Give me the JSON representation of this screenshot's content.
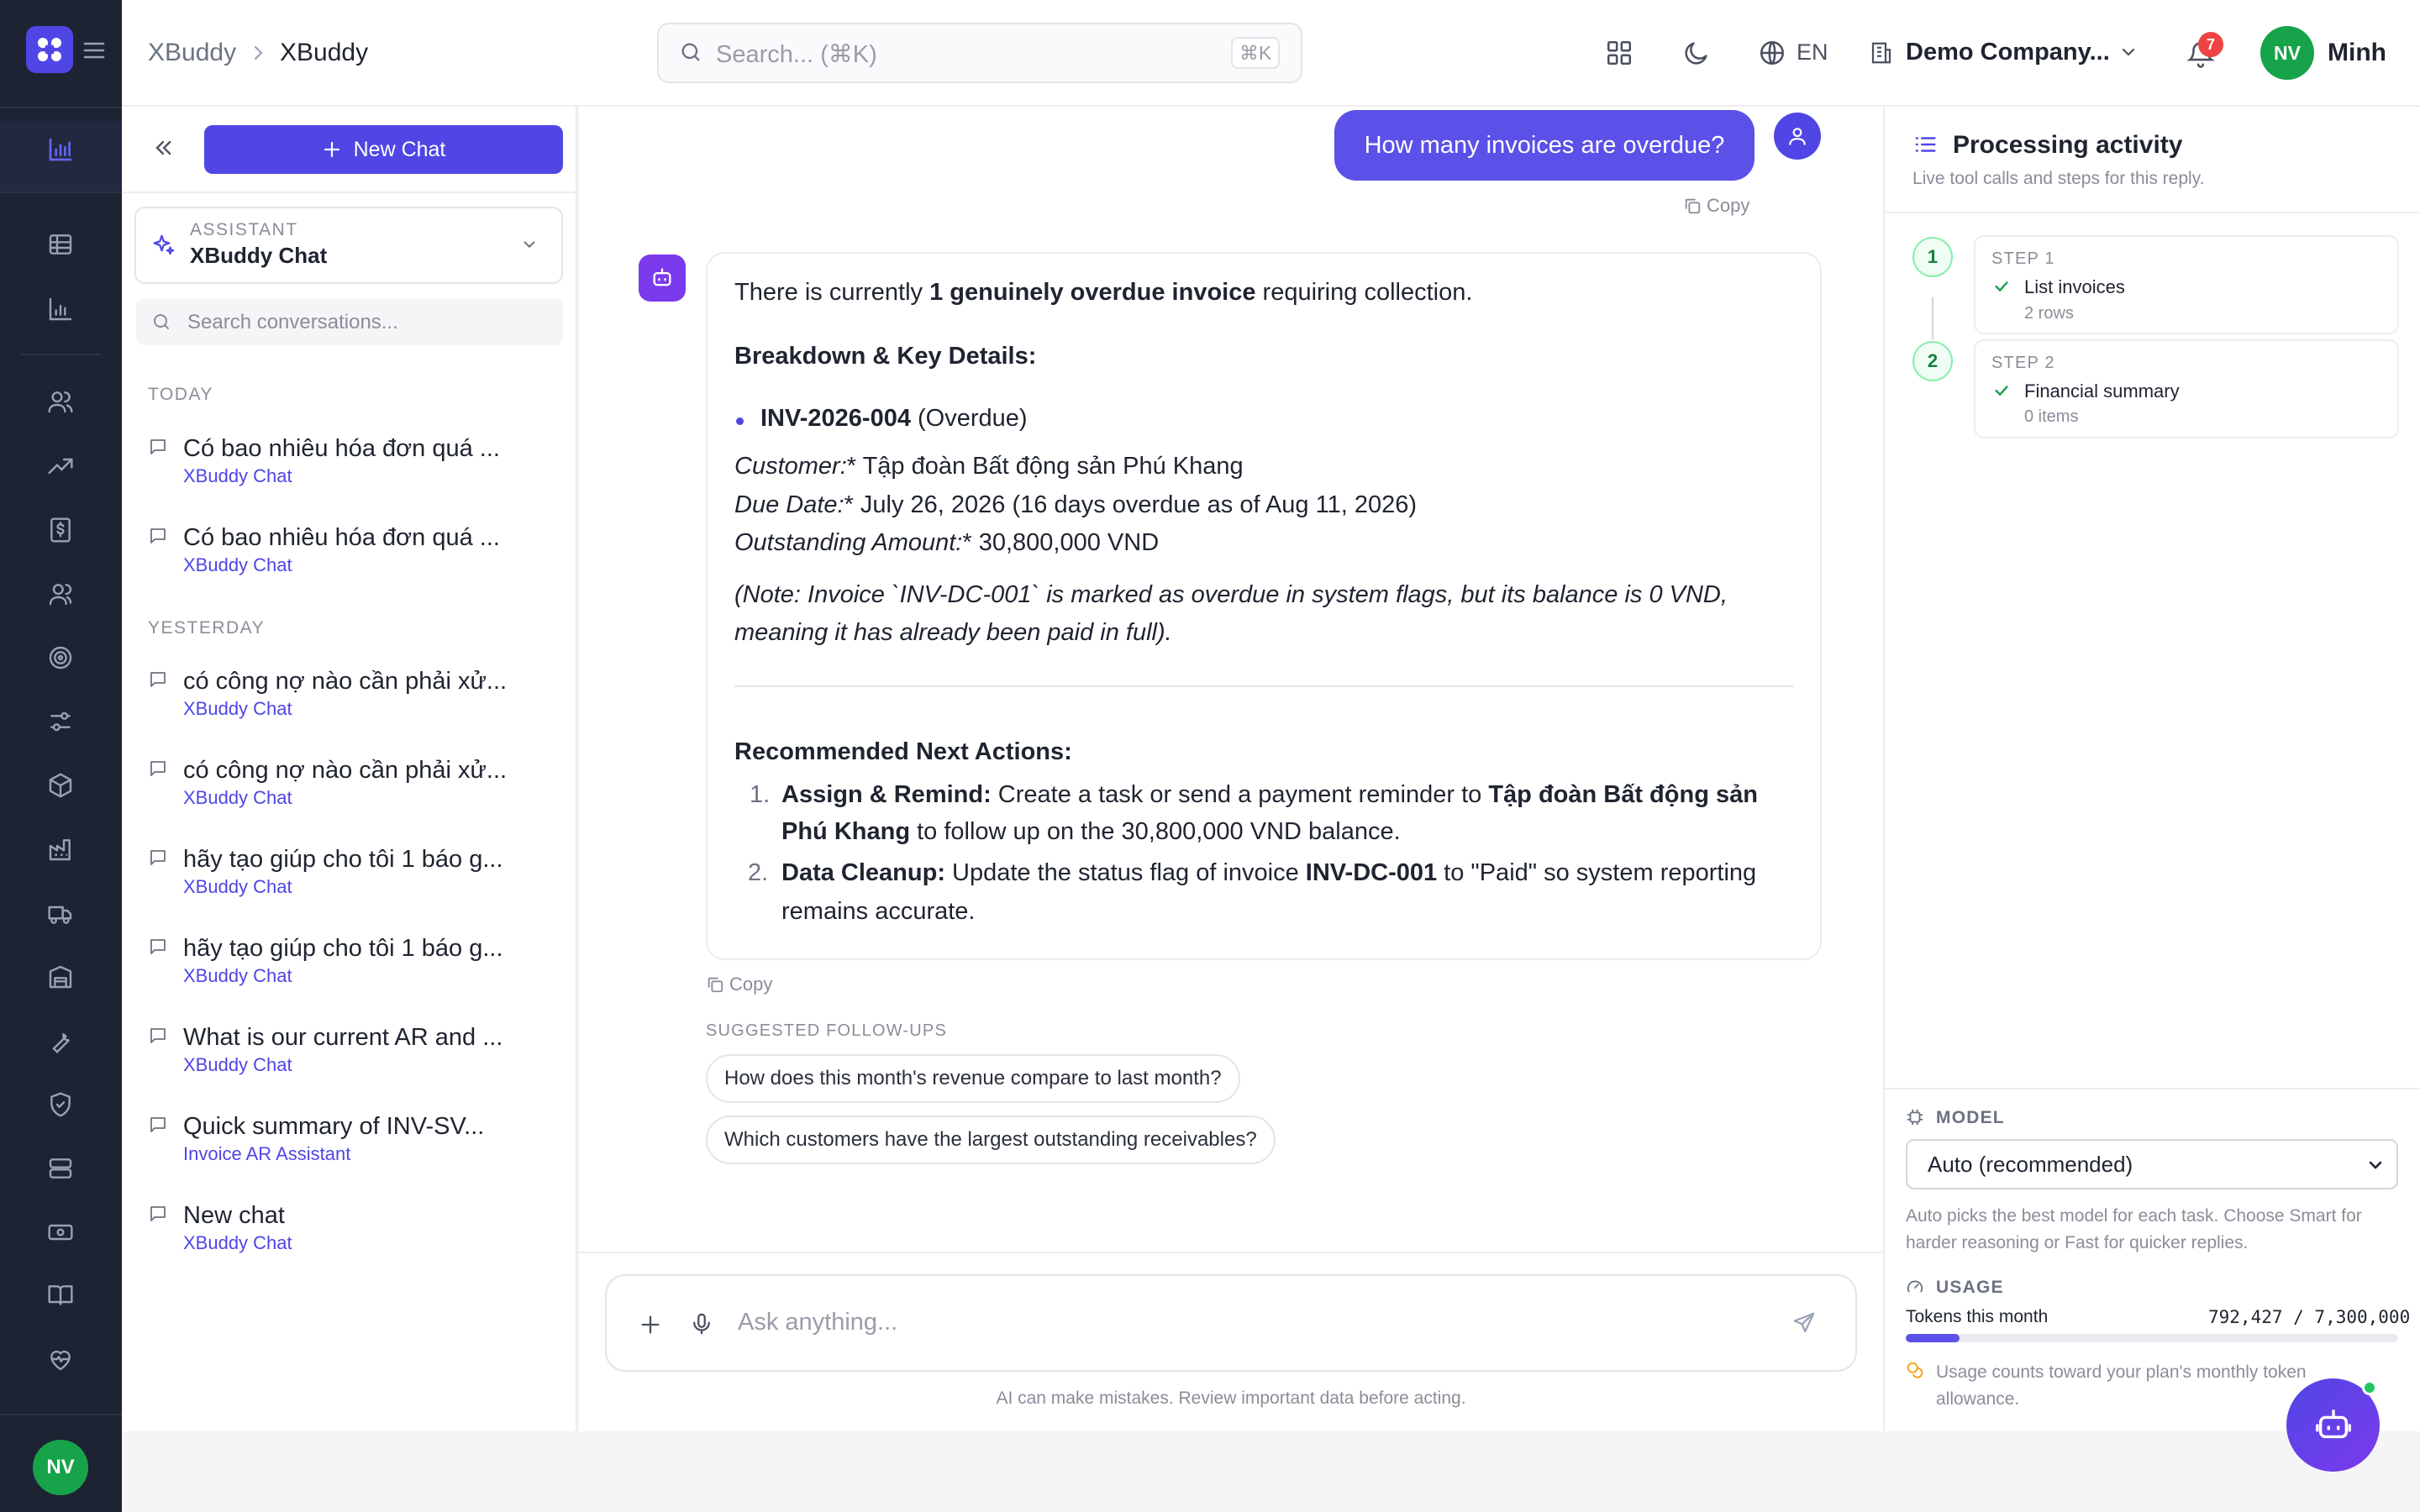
{
  "breadcrumb": {
    "parent": "XBuddy",
    "current": "XBuddy"
  },
  "search": {
    "placeholder": "Search... (⌘K)",
    "shortcut": "⌘K"
  },
  "header": {
    "language": "EN",
    "company": "Demo Company...",
    "notifications": "7",
    "user_initials": "NV",
    "user_name": "Minh"
  },
  "rail": {
    "avatar": "NV"
  },
  "sidebar": {
    "new_chat": "New Chat",
    "assistant_caption": "ASSISTANT",
    "assistant_name": "XBuddy Chat",
    "search_placeholder": "Search conversations...",
    "groups": [
      {
        "label": "TODAY",
        "items": [
          {
            "title": "Có bao nhiêu hóa đơn quá ...",
            "sub": "XBuddy Chat"
          },
          {
            "title": "Có bao nhiêu hóa đơn quá ...",
            "sub": "XBuddy Chat"
          }
        ]
      },
      {
        "label": "YESTERDAY",
        "items": [
          {
            "title": "có công nợ nào cần phải xử...",
            "sub": "XBuddy Chat"
          },
          {
            "title": "có công nợ nào cần phải xử...",
            "sub": "XBuddy Chat"
          },
          {
            "title": "hãy tạo giúp cho tôi 1 báo g...",
            "sub": "XBuddy Chat"
          },
          {
            "title": "hãy tạo giúp cho tôi 1 báo g...",
            "sub": "XBuddy Chat"
          },
          {
            "title": "What is our current AR and ...",
            "sub": "XBuddy Chat"
          },
          {
            "title": "Quick summary of INV-SV...",
            "sub": "Invoice AR Assistant"
          },
          {
            "title": "New chat",
            "sub": "XBuddy Chat"
          }
        ]
      }
    ]
  },
  "chat": {
    "user_message": "How many invoices are overdue?",
    "copy_label": "Copy",
    "reply": {
      "intro_pre": "There is currently ",
      "intro_bold": "1 genuinely overdue invoice",
      "intro_post": " requiring collection.",
      "breakdown_heading": "Breakdown & Key Details:",
      "invoice_id": "INV-2026-004",
      "invoice_status": " (Overdue)",
      "customer_label": "Customer:",
      "customer_value": "* Tập đoàn Bất động sản Phú Khang",
      "due_label": "Due Date:",
      "due_value": "* July 26, 2026 (16 days overdue as of Aug 11, 2026)",
      "amount_label": "Outstanding Amount:",
      "amount_value": "* 30,800,000 VND",
      "note_line1": "(Note: Invoice `INV-DC-001` is marked as overdue in system flags, but its balance is 0 VND,",
      "note_line2": "meaning it has already been paid in full).",
      "actions_heading": "Recommended Next Actions:",
      "action1_num": "1.",
      "action1_bold": "Assign & Remind:",
      "action1_text": " Create a task or send a payment reminder to ",
      "action1_bold2": "Tập đoàn Bất động sản",
      "action1_line2_bold": "Phú Khang",
      "action1_line2_text": " to follow up on the 30,800,000 VND balance.",
      "action2_num": "2.",
      "action2_bold": "Data Cleanup:",
      "action2_text": " Update the status flag of invoice ",
      "action2_bold2": "INV-DC-001",
      "action2_text2": " to \"Paid\" so system reporting",
      "action2_line2": "remains accurate."
    },
    "suggest_caption": "SUGGESTED FOLLOW-UPS",
    "suggestions": [
      "How does this month's revenue compare to last month?",
      "Which customers have the largest outstanding receivables?"
    ],
    "composer_placeholder": "Ask anything...",
    "disclaimer": "AI can make mistakes. Review important data before acting."
  },
  "activity": {
    "title": "Processing activity",
    "subtitle": "Live tool calls and steps for this reply.",
    "steps": [
      {
        "num": "1",
        "caption": "STEP 1",
        "name": "List invoices",
        "meta": "2 rows"
      },
      {
        "num": "2",
        "caption": "STEP 2",
        "name": "Financial summary",
        "meta": "0 items"
      }
    ],
    "model_caption": "MODEL",
    "model_value": "Auto (recommended)",
    "model_help": "Auto picks the best model for each task. Choose Smart for harder reasoning or Fast for quicker replies.",
    "usage_caption": "USAGE",
    "tokens_label": "Tokens this month",
    "tokens_value": "792,427 / 7,300,000",
    "tokens_used": 792427,
    "tokens_limit": 7300000,
    "usage_note": "Usage counts toward your plan's monthly token allowance."
  },
  "colors": {
    "accent": "#4f46e5",
    "rail": "#1e2333",
    "success": "#16a34a",
    "danger": "#ef4444"
  }
}
